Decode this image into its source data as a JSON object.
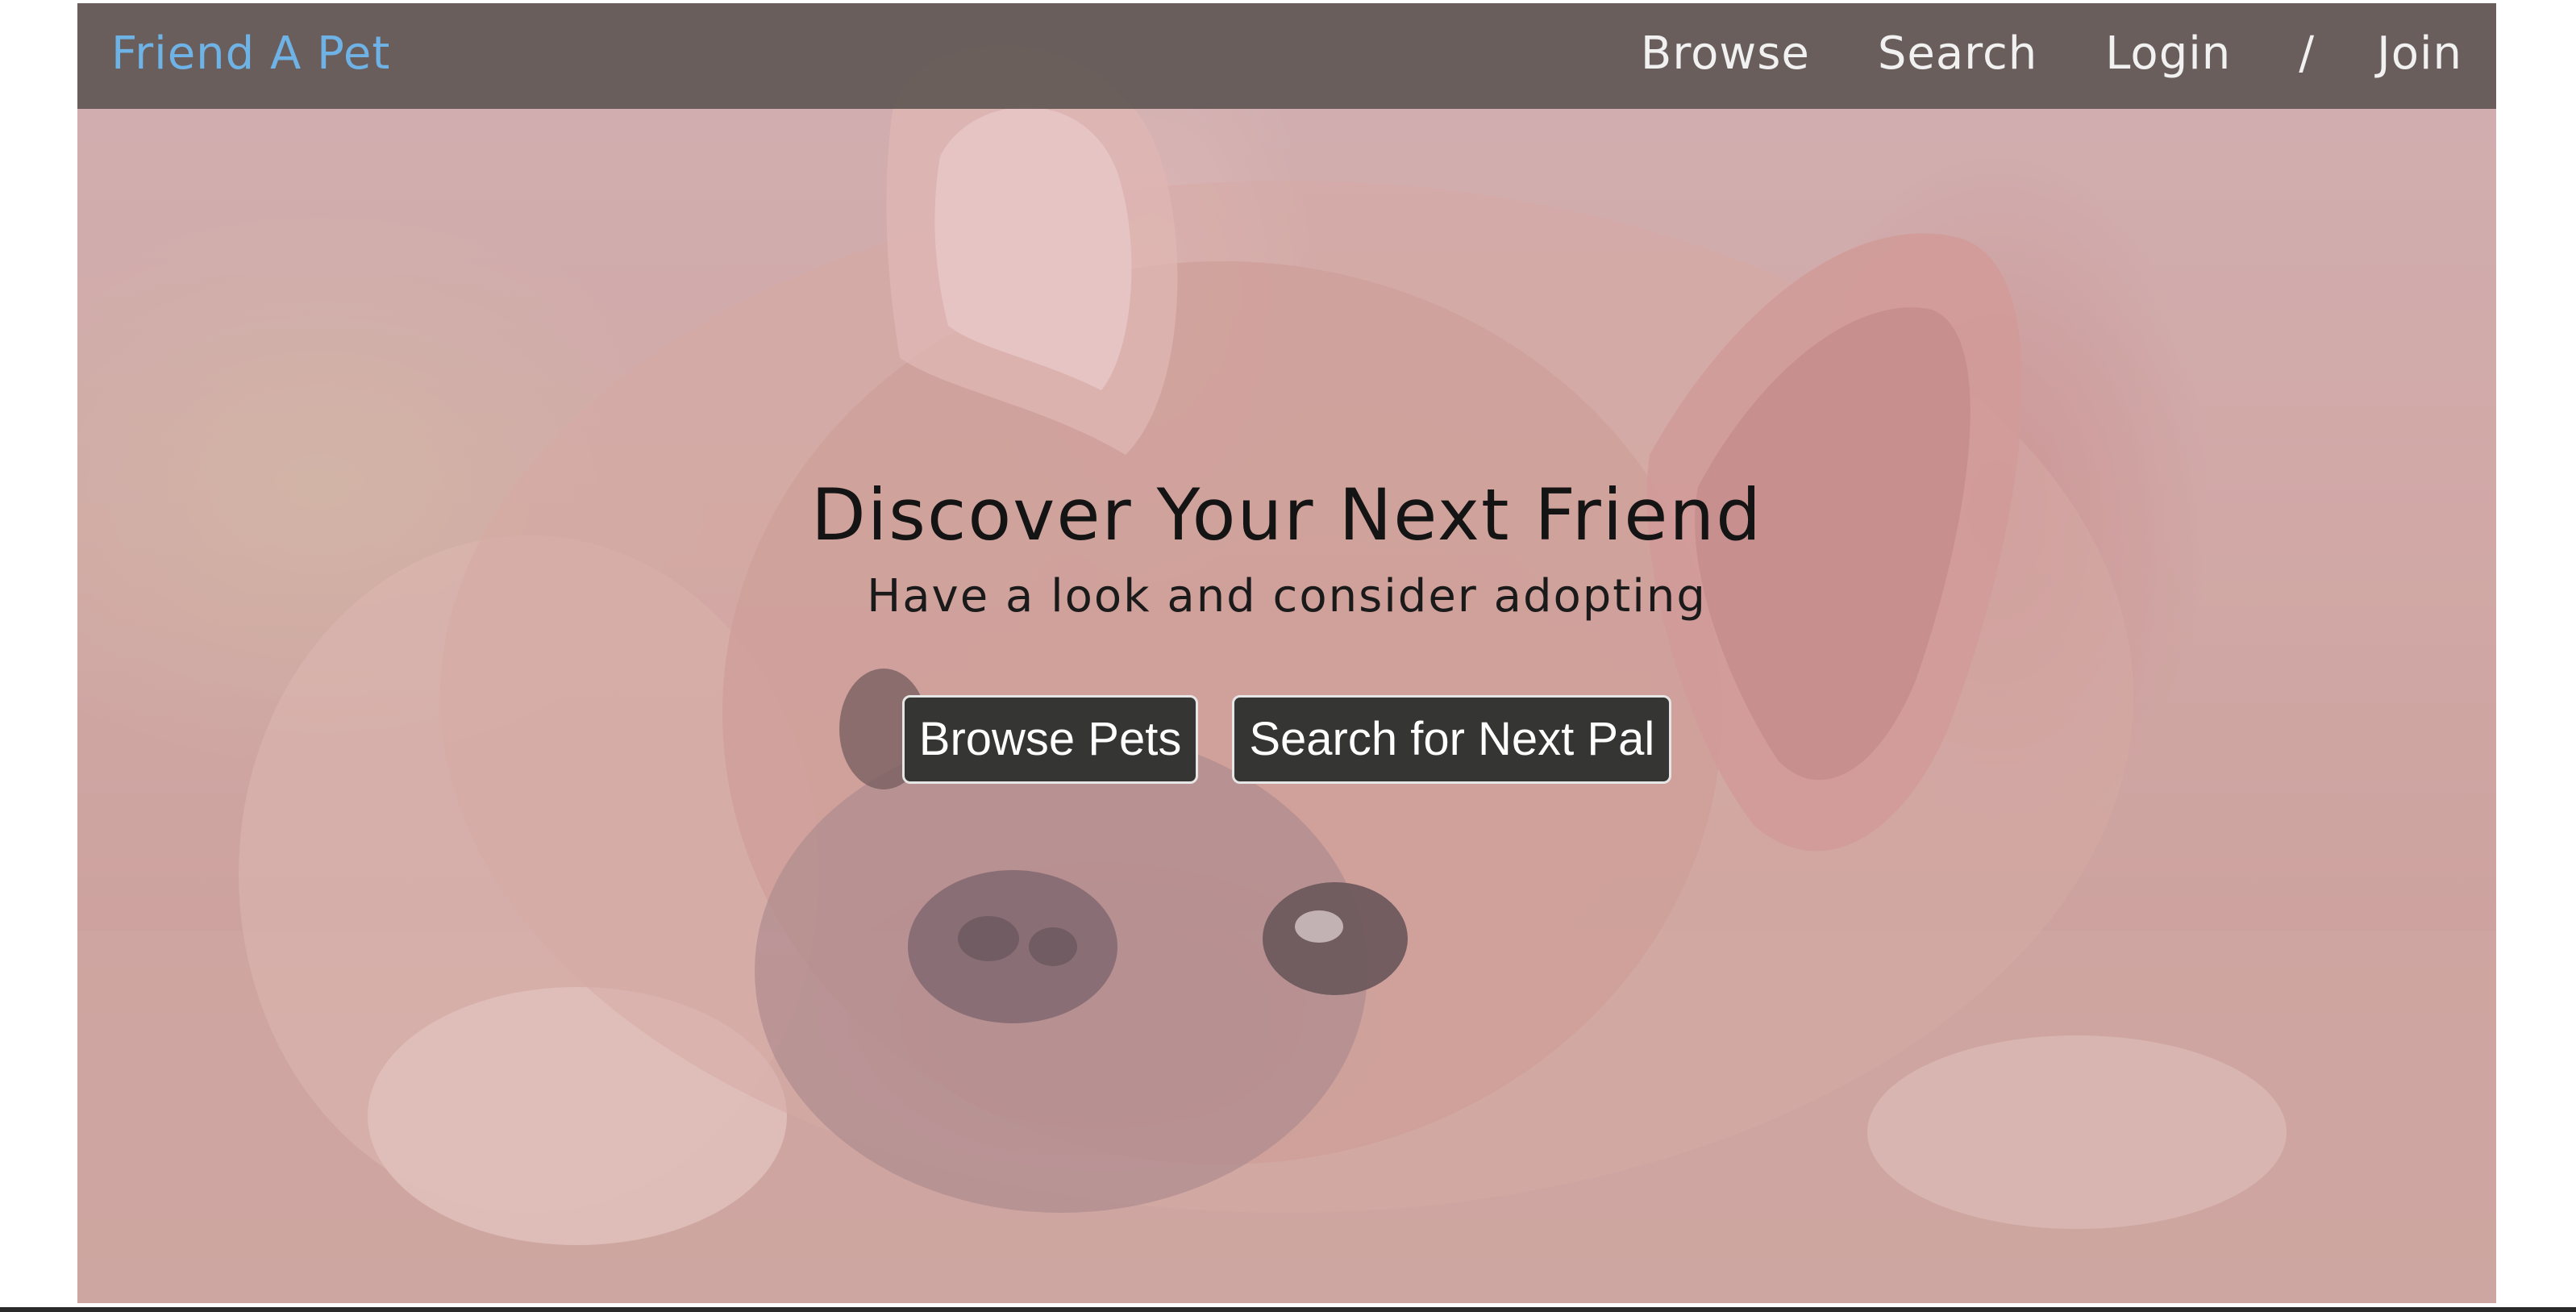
{
  "nav": {
    "brand": "Friend A Pet",
    "links": [
      {
        "label": "Browse"
      },
      {
        "label": "Search"
      },
      {
        "label": "Login"
      },
      {
        "label": "Join"
      }
    ],
    "separator": "/"
  },
  "hero": {
    "title": "Discover Your Next Friend",
    "subtitle": "Have a look and consider adopting",
    "background_image": "french-bulldog-photo",
    "buttons": {
      "browse_label": "Browse Pets",
      "search_label": "Search for Next Pal"
    }
  },
  "colors": {
    "brand": "#6eb2e6",
    "navbar_bg": "#58504e",
    "nav_text": "#f1f1f1",
    "button_bg": "#353533",
    "button_text": "#ffffff",
    "hero_text": "#141414"
  }
}
